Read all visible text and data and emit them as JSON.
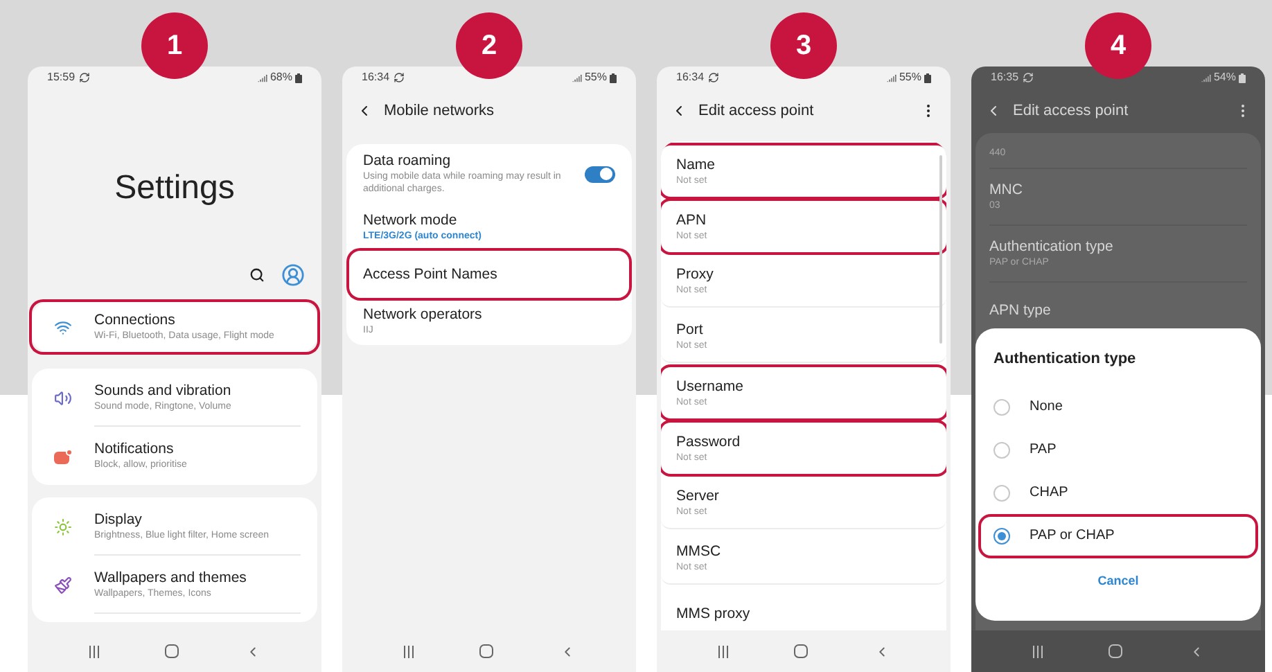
{
  "steps": [
    {
      "kind": "settings",
      "badge": "1",
      "status": {
        "time": "15:59",
        "battery": "68%"
      },
      "title": "Settings",
      "groups": [
        {
          "items": [
            {
              "title": "Connections",
              "subtitle": "Wi-Fi, Bluetooth, Data usage, Flight mode",
              "highlighted": true
            }
          ]
        },
        {
          "items": [
            {
              "title": "Sounds and vibration",
              "subtitle": "Sound mode, Ringtone, Volume",
              "highlighted": false
            },
            {
              "title": "Notifications",
              "subtitle": "Block, allow, prioritise",
              "highlighted": false
            }
          ]
        },
        {
          "items": [
            {
              "title": "Display",
              "subtitle": "Brightness, Blue light filter, Home screen",
              "highlighted": false
            },
            {
              "title": "Wallpapers and themes",
              "subtitle": "Wallpapers, Themes, Icons",
              "highlighted": false
            }
          ]
        }
      ]
    },
    {
      "kind": "network",
      "badge": "2",
      "status": {
        "time": "16:34",
        "battery": "55%"
      },
      "header": {
        "title": "Mobile networks",
        "more_menu": false
      },
      "items": [
        {
          "kind": "toggle",
          "title": "Data roaming",
          "subtitle": "Using mobile data while roaming may result in additional charges.",
          "on": true,
          "highlighted": false
        },
        {
          "kind": "value",
          "title": "Network mode",
          "value": "LTE/3G/2G (auto connect)",
          "highlighted": false
        },
        {
          "kind": "plain",
          "title": "Access Point Names",
          "highlighted": true
        },
        {
          "kind": "plain",
          "title": "Network operators",
          "subtitle": "IIJ",
          "highlighted": false
        }
      ]
    },
    {
      "kind": "apn",
      "badge": "3",
      "status": {
        "time": "16:34",
        "battery": "55%"
      },
      "header": {
        "title": "Edit access point",
        "more_menu": true
      },
      "items": [
        {
          "title": "Name",
          "subtitle": "Not set",
          "highlighted": true
        },
        {
          "title": "APN",
          "subtitle": "Not set",
          "highlighted": true
        },
        {
          "title": "Proxy",
          "subtitle": "Not set",
          "highlighted": false
        },
        {
          "title": "Port",
          "subtitle": "Not set",
          "highlighted": false
        },
        {
          "title": "Username",
          "subtitle": "Not set",
          "highlighted": true
        },
        {
          "title": "Password",
          "subtitle": "Not set",
          "highlighted": true
        },
        {
          "title": "Server",
          "subtitle": "Not set",
          "highlighted": false
        },
        {
          "title": "MMSC",
          "subtitle": "Not set",
          "highlighted": false
        },
        {
          "title": "MMS proxy",
          "highlighted": false
        }
      ]
    },
    {
      "kind": "dialog",
      "badge": "4",
      "status": {
        "time": "16:35",
        "battery": "54%"
      },
      "header": {
        "title": "Edit access point",
        "more_menu": true
      },
      "items": [
        {
          "subtitle": "440"
        },
        {
          "title": "MNC",
          "subtitle": "03"
        },
        {
          "title": "Authentication type",
          "subtitle": "PAP or CHAP"
        },
        {
          "title": "APN type"
        }
      ],
      "dialog": {
        "title": "Authentication type",
        "options": [
          {
            "label": "None",
            "selected": false,
            "highlighted": false
          },
          {
            "label": "PAP",
            "selected": false,
            "highlighted": false
          },
          {
            "label": "CHAP",
            "selected": false,
            "highlighted": false
          },
          {
            "label": "PAP or CHAP",
            "selected": true,
            "highlighted": true
          }
        ],
        "cancel": "Cancel"
      }
    }
  ]
}
